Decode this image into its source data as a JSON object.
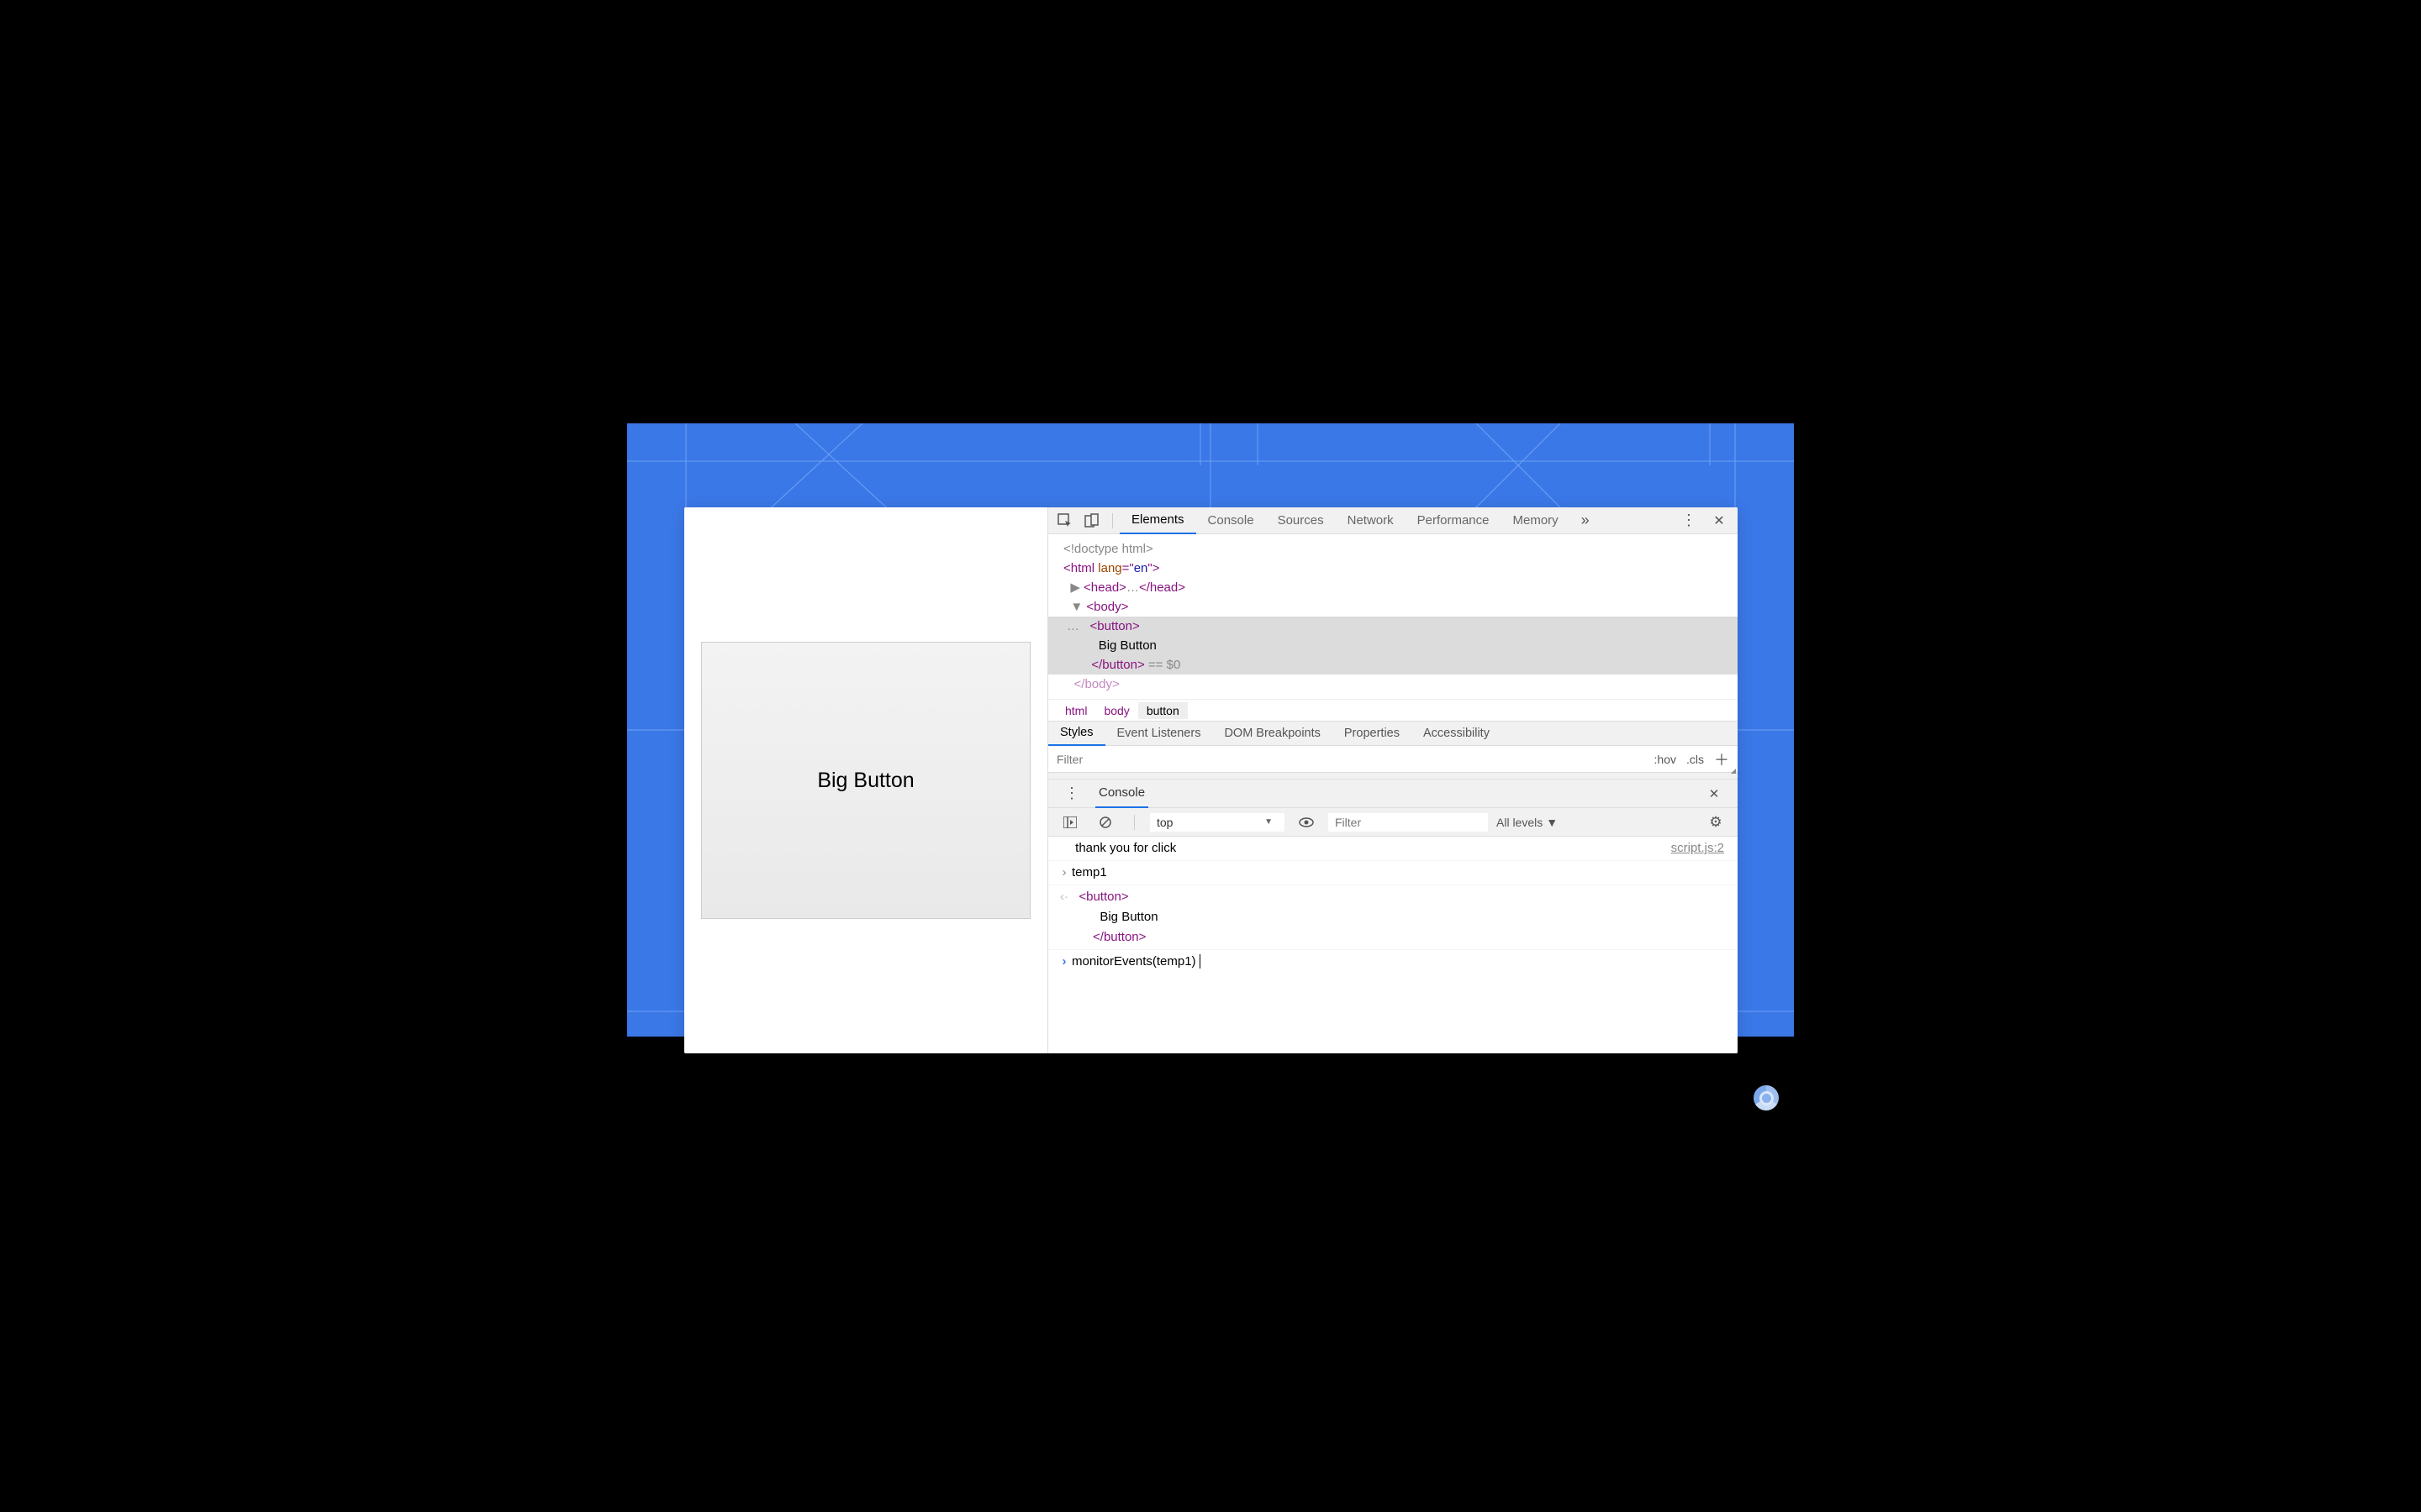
{
  "page": {
    "big_button_label": "Big Button"
  },
  "toolbar": {
    "tabs": [
      "Elements",
      "Console",
      "Sources",
      "Network",
      "Performance",
      "Memory"
    ],
    "active_tab": "Elements"
  },
  "dom": {
    "doctype": "<!doctype html>",
    "html_open": "<html lang=\"en\">",
    "head_collapsed": "<head>…</head>",
    "body_open": "<body>",
    "button_open": "<button>",
    "button_text": "Big Button",
    "button_close": "</button>",
    "selected_suffix": " == $0",
    "body_close_partial": "</body>"
  },
  "crumbs": [
    "html",
    "body",
    "button"
  ],
  "subtabs": [
    "Styles",
    "Event Listeners",
    "DOM Breakpoints",
    "Properties",
    "Accessibility"
  ],
  "styles": {
    "filter_placeholder": "Filter",
    "hov": ":hov",
    "cls": ".cls"
  },
  "console": {
    "header_title": "Console",
    "context": "top",
    "filter_placeholder": "Filter",
    "levels": "All levels",
    "log_text": "thank you for click",
    "log_source": "script.js:2",
    "input_history": "temp1",
    "output_button_open": "<button>",
    "output_button_text": "Big Button",
    "output_button_close": "</button>",
    "current_input": "monitorEvents(temp1)"
  }
}
